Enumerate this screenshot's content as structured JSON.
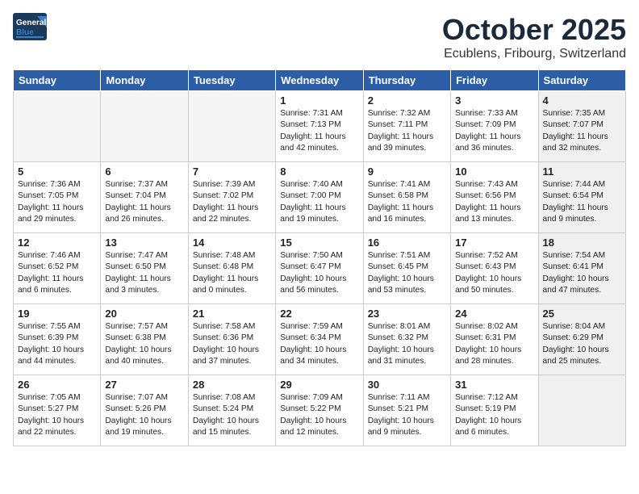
{
  "header": {
    "logo_general": "General",
    "logo_blue": "Blue",
    "title": "October 2025",
    "subtitle": "Ecublens, Fribourg, Switzerland"
  },
  "days_of_week": [
    "Sunday",
    "Monday",
    "Tuesday",
    "Wednesday",
    "Thursday",
    "Friday",
    "Saturday"
  ],
  "weeks": [
    [
      {
        "day": null,
        "content": null,
        "shaded": false
      },
      {
        "day": null,
        "content": null,
        "shaded": false
      },
      {
        "day": null,
        "content": null,
        "shaded": false
      },
      {
        "day": "1",
        "content": "Sunrise: 7:31 AM\nSunset: 7:13 PM\nDaylight: 11 hours and 42 minutes.",
        "shaded": false
      },
      {
        "day": "2",
        "content": "Sunrise: 7:32 AM\nSunset: 7:11 PM\nDaylight: 11 hours and 39 minutes.",
        "shaded": false
      },
      {
        "day": "3",
        "content": "Sunrise: 7:33 AM\nSunset: 7:09 PM\nDaylight: 11 hours and 36 minutes.",
        "shaded": false
      },
      {
        "day": "4",
        "content": "Sunrise: 7:35 AM\nSunset: 7:07 PM\nDaylight: 11 hours and 32 minutes.",
        "shaded": true
      }
    ],
    [
      {
        "day": "5",
        "content": "Sunrise: 7:36 AM\nSunset: 7:05 PM\nDaylight: 11 hours and 29 minutes.",
        "shaded": false
      },
      {
        "day": "6",
        "content": "Sunrise: 7:37 AM\nSunset: 7:04 PM\nDaylight: 11 hours and 26 minutes.",
        "shaded": false
      },
      {
        "day": "7",
        "content": "Sunrise: 7:39 AM\nSunset: 7:02 PM\nDaylight: 11 hours and 22 minutes.",
        "shaded": false
      },
      {
        "day": "8",
        "content": "Sunrise: 7:40 AM\nSunset: 7:00 PM\nDaylight: 11 hours and 19 minutes.",
        "shaded": false
      },
      {
        "day": "9",
        "content": "Sunrise: 7:41 AM\nSunset: 6:58 PM\nDaylight: 11 hours and 16 minutes.",
        "shaded": false
      },
      {
        "day": "10",
        "content": "Sunrise: 7:43 AM\nSunset: 6:56 PM\nDaylight: 11 hours and 13 minutes.",
        "shaded": false
      },
      {
        "day": "11",
        "content": "Sunrise: 7:44 AM\nSunset: 6:54 PM\nDaylight: 11 hours and 9 minutes.",
        "shaded": true
      }
    ],
    [
      {
        "day": "12",
        "content": "Sunrise: 7:46 AM\nSunset: 6:52 PM\nDaylight: 11 hours and 6 minutes.",
        "shaded": false
      },
      {
        "day": "13",
        "content": "Sunrise: 7:47 AM\nSunset: 6:50 PM\nDaylight: 11 hours and 3 minutes.",
        "shaded": false
      },
      {
        "day": "14",
        "content": "Sunrise: 7:48 AM\nSunset: 6:48 PM\nDaylight: 11 hours and 0 minutes.",
        "shaded": false
      },
      {
        "day": "15",
        "content": "Sunrise: 7:50 AM\nSunset: 6:47 PM\nDaylight: 10 hours and 56 minutes.",
        "shaded": false
      },
      {
        "day": "16",
        "content": "Sunrise: 7:51 AM\nSunset: 6:45 PM\nDaylight: 10 hours and 53 minutes.",
        "shaded": false
      },
      {
        "day": "17",
        "content": "Sunrise: 7:52 AM\nSunset: 6:43 PM\nDaylight: 10 hours and 50 minutes.",
        "shaded": false
      },
      {
        "day": "18",
        "content": "Sunrise: 7:54 AM\nSunset: 6:41 PM\nDaylight: 10 hours and 47 minutes.",
        "shaded": true
      }
    ],
    [
      {
        "day": "19",
        "content": "Sunrise: 7:55 AM\nSunset: 6:39 PM\nDaylight: 10 hours and 44 minutes.",
        "shaded": false
      },
      {
        "day": "20",
        "content": "Sunrise: 7:57 AM\nSunset: 6:38 PM\nDaylight: 10 hours and 40 minutes.",
        "shaded": false
      },
      {
        "day": "21",
        "content": "Sunrise: 7:58 AM\nSunset: 6:36 PM\nDaylight: 10 hours and 37 minutes.",
        "shaded": false
      },
      {
        "day": "22",
        "content": "Sunrise: 7:59 AM\nSunset: 6:34 PM\nDaylight: 10 hours and 34 minutes.",
        "shaded": false
      },
      {
        "day": "23",
        "content": "Sunrise: 8:01 AM\nSunset: 6:32 PM\nDaylight: 10 hours and 31 minutes.",
        "shaded": false
      },
      {
        "day": "24",
        "content": "Sunrise: 8:02 AM\nSunset: 6:31 PM\nDaylight: 10 hours and 28 minutes.",
        "shaded": false
      },
      {
        "day": "25",
        "content": "Sunrise: 8:04 AM\nSunset: 6:29 PM\nDaylight: 10 hours and 25 minutes.",
        "shaded": true
      }
    ],
    [
      {
        "day": "26",
        "content": "Sunrise: 7:05 AM\nSunset: 5:27 PM\nDaylight: 10 hours and 22 minutes.",
        "shaded": false
      },
      {
        "day": "27",
        "content": "Sunrise: 7:07 AM\nSunset: 5:26 PM\nDaylight: 10 hours and 19 minutes.",
        "shaded": false
      },
      {
        "day": "28",
        "content": "Sunrise: 7:08 AM\nSunset: 5:24 PM\nDaylight: 10 hours and 15 minutes.",
        "shaded": false
      },
      {
        "day": "29",
        "content": "Sunrise: 7:09 AM\nSunset: 5:22 PM\nDaylight: 10 hours and 12 minutes.",
        "shaded": false
      },
      {
        "day": "30",
        "content": "Sunrise: 7:11 AM\nSunset: 5:21 PM\nDaylight: 10 hours and 9 minutes.",
        "shaded": false
      },
      {
        "day": "31",
        "content": "Sunrise: 7:12 AM\nSunset: 5:19 PM\nDaylight: 10 hours and 6 minutes.",
        "shaded": false
      },
      {
        "day": null,
        "content": null,
        "shaded": true
      }
    ]
  ]
}
